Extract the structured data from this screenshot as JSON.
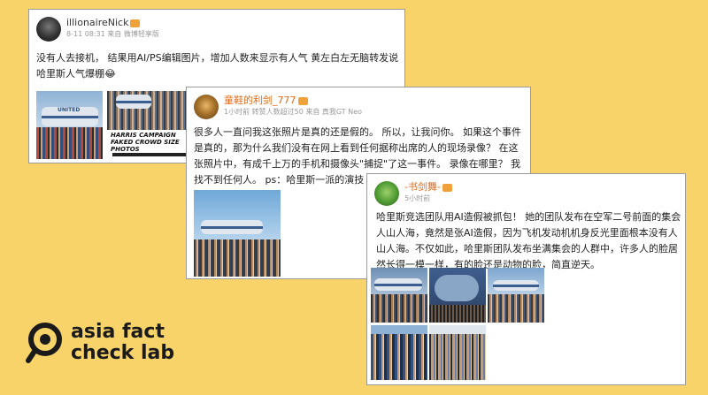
{
  "post1": {
    "username": "illionaireNick",
    "meta": "8-11 08:31 来自 微博轻享版",
    "text": "没有人去接机， 结果用AI/PS编辑图片，增加人数来显示有人气 黄左白左无脑转发说哈里斯人气爆棚😂",
    "img2_caption": "HARRIS CAMPAIGN FAKED CROWD SIZE PHOTOS",
    "img1_plane_text": "UNITED"
  },
  "post2": {
    "username": "童鞋的利剑_777",
    "meta": "1小时前 转赞人数超过50 来自 真我GT Neo",
    "text": "很多人一直问我这张照片是真的还是假的。 所以，让我问你。 如果这个事件是真的，那为什么我们没有在网上看到任何据称出席的人的现场录像？ 在这张照片中，有成千上万的手机和摄像头\"捕捉\"了这一事件。 录像在哪里？ 我找不到任何人。 ps：哈里斯一派的演技"
  },
  "post3": {
    "username": "-书剑舞-",
    "meta": "5小时前",
    "text": "哈里斯竞选团队用AI造假被抓包！ 她的团队发布在空军二号前面的集会人山人海，竟然是张AI造假，因为飞机发动机机身反光里面根本没有人山人海。不仅如此，哈里斯团队发布坐满集会的人群中，许多人的脸居然长得一模一样，有的脸还是动物的脸，简直逆天。"
  },
  "logo": {
    "line1": "asia fact",
    "line2": "check lab"
  },
  "colors": {
    "background": "#f8d36a",
    "crown": "#f0a23a",
    "logo_text": "#1a1a1a"
  }
}
